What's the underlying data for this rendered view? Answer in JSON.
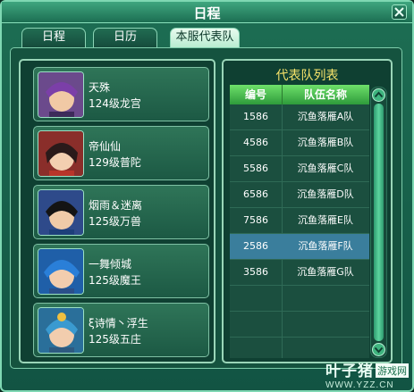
{
  "window": {
    "title": "日程"
  },
  "tabs": [
    {
      "label": "日程"
    },
    {
      "label": "日历"
    },
    {
      "label": "本服代表队"
    }
  ],
  "members": [
    {
      "name": "天殊",
      "level": "124级龙宫"
    },
    {
      "name": "帝仙仙",
      "level": "129级普陀"
    },
    {
      "name": "烟雨＆迷离",
      "level": "125级万兽"
    },
    {
      "name": "一舞倾城",
      "level": "125级魔王"
    },
    {
      "name": "ξ诗情丶浮生",
      "level": "125级五庄"
    }
  ],
  "team_list": {
    "title": "代表队列表",
    "headers": {
      "id": "编号",
      "name": "队伍名称"
    },
    "rows": [
      {
        "id": "1586",
        "name": "沉鱼落雁A队"
      },
      {
        "id": "4586",
        "name": "沉鱼落雁B队"
      },
      {
        "id": "5586",
        "name": "沉鱼落雁C队"
      },
      {
        "id": "6586",
        "name": "沉鱼落雁D队"
      },
      {
        "id": "7586",
        "name": "沉鱼落雁E队"
      },
      {
        "id": "2586",
        "name": "沉鱼落雁F队"
      },
      {
        "id": "3586",
        "name": "沉鱼落雁G队"
      }
    ],
    "selected_index": 5
  },
  "watermark": {
    "text": "叶子猪",
    "badge": "游戏网",
    "url": "WWW.YZZ.CN"
  },
  "colors": {
    "accent": "#7fd8b3",
    "selected_row": "#3a7e9c",
    "list_title": "#f7e36a"
  }
}
